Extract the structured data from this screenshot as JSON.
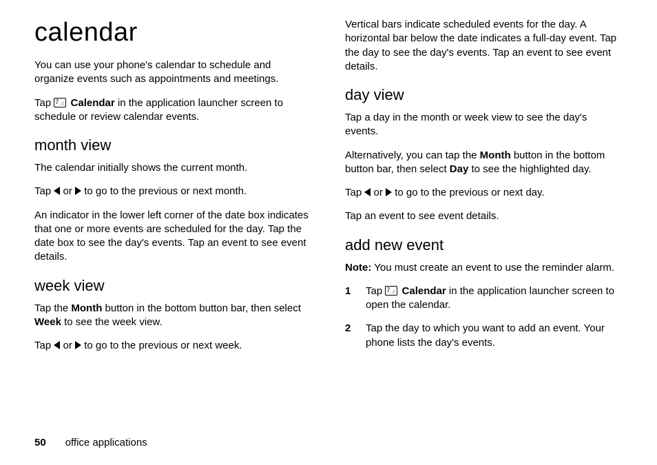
{
  "title": "calendar",
  "intro1": "You can use your phone's calendar to schedule and organize events such as appointments and meetings.",
  "intro2_a": "Tap ",
  "intro2_icon_name": "calendar-icon",
  "intro2_b": "Calendar",
  "intro2_c": " in the application launcher screen to schedule or review calendar events.",
  "month": {
    "heading": "month view",
    "p1": "The calendar initially shows the current month.",
    "p2_a": "Tap ",
    "p2_b": " or ",
    "p2_c": " to go to the previous or next month.",
    "p3": "An indicator in the lower left corner of the date box indicates that one or more events are scheduled for the day. Tap the date box to see the day's events. Tap an event to see event details."
  },
  "week": {
    "heading": "week view",
    "p1_a": "Tap the ",
    "p1_b": "Month",
    "p1_c": " button in the bottom button bar, then select ",
    "p1_d": "Week",
    "p1_e": " to see the week view.",
    "p2_a": "Tap ",
    "p2_b": " or ",
    "p2_c": " to go to the previous or next week."
  },
  "right_top": "Vertical bars indicate scheduled events for the day. A horizontal bar below the date indicates a full-day event. Tap the day to see the day's events. Tap an event to see event details.",
  "day": {
    "heading": "day view",
    "p1": "Tap a day in the month or week view to see the day's events.",
    "p2_a": "Alternatively, you can tap the ",
    "p2_b": "Month",
    "p2_c": " button in the bottom button bar, then select ",
    "p2_d": "Day",
    "p2_e": " to see the highlighted day.",
    "p3_a": "Tap ",
    "p3_b": " or ",
    "p3_c": " to go to the previous or next day.",
    "p4": "Tap an event to see event details."
  },
  "add": {
    "heading": "add new event",
    "note_label": "Note:",
    "note_text": " You must create an event to use the reminder alarm.",
    "steps": [
      {
        "num": "1",
        "a": "Tap ",
        "b": "Calendar",
        "c": " in the application launcher screen to open the calendar."
      },
      {
        "num": "2",
        "text": "Tap the day to which you want to add an event. Your phone lists the day's events."
      }
    ]
  },
  "footer": {
    "page": "50",
    "section": "office applications"
  }
}
